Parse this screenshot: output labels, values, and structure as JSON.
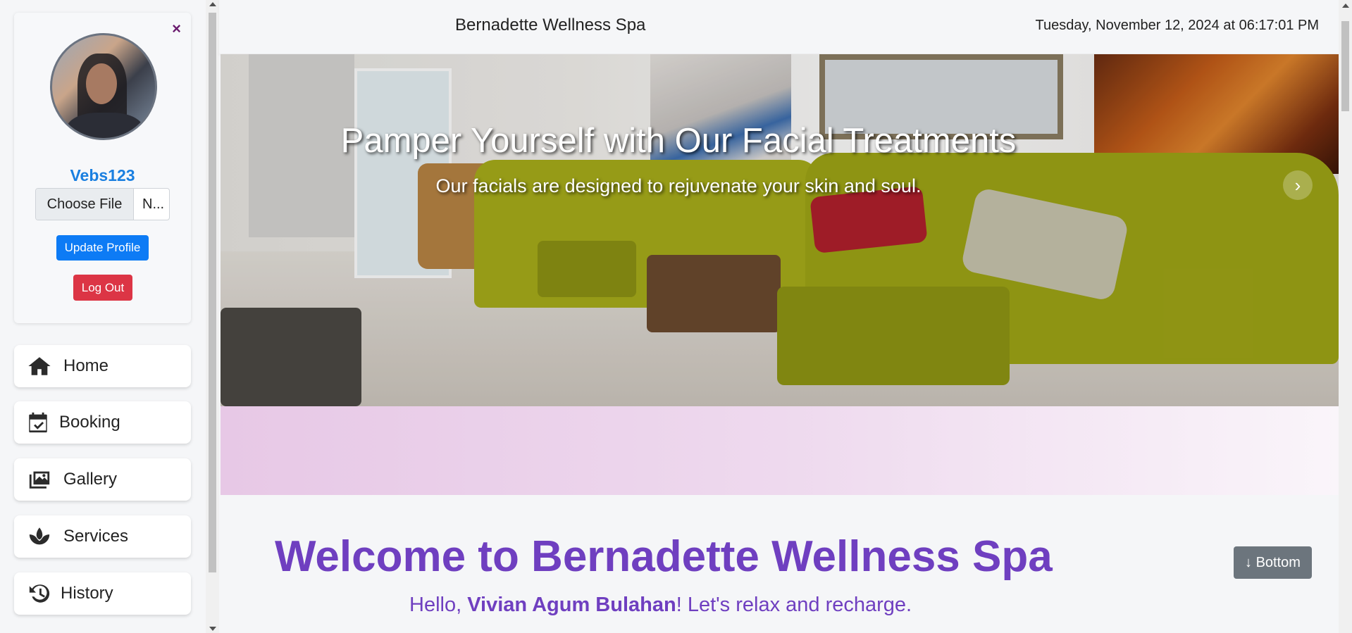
{
  "profile": {
    "username": "Vebs123",
    "file_choose_label": "Choose File",
    "file_name": "N...",
    "update_label": "Update Profile",
    "logout_label": "Log Out",
    "close_symbol": "×"
  },
  "nav": {
    "items": [
      {
        "label": "Home",
        "icon": "home-icon"
      },
      {
        "label": "Booking",
        "icon": "calendar-check-icon"
      },
      {
        "label": "Gallery",
        "icon": "images-icon"
      },
      {
        "label": "Services",
        "icon": "lotus-icon"
      },
      {
        "label": "History",
        "icon": "history-icon"
      }
    ]
  },
  "header": {
    "brand": "Bernadette Wellness Spa",
    "datetime": "Tuesday, November 12, 2024 at 06:17:01 PM"
  },
  "hero": {
    "title": "Pamper Yourself with Our Facial Treatments",
    "subtitle": "Our facials are designed to rejuvenate your skin and soul."
  },
  "main": {
    "welcome": "Welcome to Bernadette Wellness Spa",
    "hello_prefix": "Hello, ",
    "hello_name": "Vivian Agum Bulahan",
    "hello_suffix": "! Let's relax and recharge.",
    "bottom_button": "↓ Bottom"
  },
  "colors": {
    "accent_purple": "#6f3fc0",
    "link_blue": "#1a7fe0",
    "primary": "#0d7bf5",
    "danger": "#dc3545",
    "secondary": "#6c757d"
  }
}
